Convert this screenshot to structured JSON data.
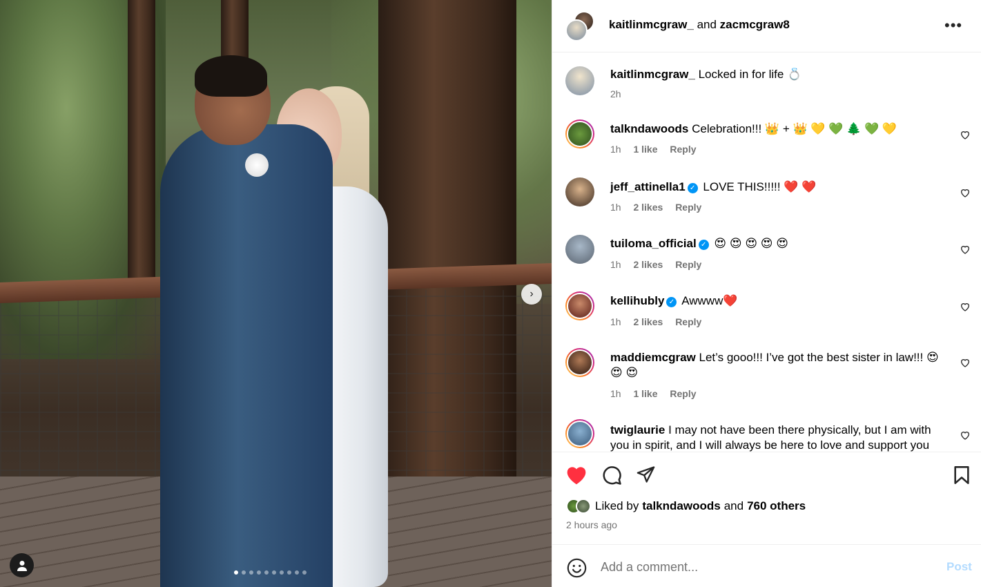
{
  "post": {
    "header": {
      "user1": "kaitlinmcgraw_",
      "connector": "and",
      "user2": "zacmcgraw8",
      "more_icon": "more-horizontal-icon"
    },
    "caption": {
      "user": "kaitlinmcgraw_",
      "text": "Locked in for life 💍",
      "time": "2h"
    },
    "carousel": {
      "dot_count": 10,
      "active_index": 0
    },
    "comments": [
      {
        "user": "talkndawoods",
        "verified": false,
        "text": "Celebration!!! 👑 + 👑  💛 💚 🌲 💚 💛",
        "time": "1h",
        "likes": "1 like",
        "reply": "Reply"
      },
      {
        "user": "jeff_attinella1",
        "verified": true,
        "text": "LOVE THIS!!!!! ❤️ ❤️",
        "time": "1h",
        "likes": "2 likes",
        "reply": "Reply"
      },
      {
        "user": "tuiloma_official",
        "verified": true,
        "text": "😍 😍 😍 😍 😍",
        "time": "1h",
        "likes": "2 likes",
        "reply": "Reply"
      },
      {
        "user": "kellihubly",
        "verified": true,
        "text": "Awwww❤️",
        "time": "1h",
        "likes": "2 likes",
        "reply": "Reply"
      },
      {
        "user": "maddiemcgraw",
        "verified": false,
        "text": "Let’s gooo!!! I’ve got the best sister in law!!! 😍 😍 😍",
        "time": "1h",
        "likes": "1 like",
        "reply": "Reply"
      },
      {
        "user": "twiglaurie",
        "verified": false,
        "text": "I may not have been there physically, but I am with you in spirit, and I will always be here to love and support you"
      }
    ],
    "likes": {
      "prefix": "Liked by",
      "user": "talkndawoods",
      "joiner": "and",
      "others": "760 others"
    },
    "timestamp": "2 hours ago",
    "add_comment": {
      "placeholder": "Add a comment...",
      "post_label": "Post"
    },
    "colors": {
      "like_red": "#ff3040",
      "link_blue": "#0095f6",
      "post_disabled": "#b3dbff",
      "meta_gray": "#737373"
    }
  }
}
